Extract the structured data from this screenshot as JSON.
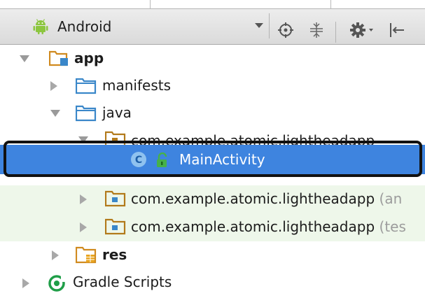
{
  "toolbar": {
    "view_label": "Android",
    "icons": [
      "android-icon",
      "chevron-down-icon",
      "sync-target-icon",
      "collapse-all-icon",
      "settings-gear-icon",
      "hide-panel-icon"
    ]
  },
  "tree": {
    "app": "app",
    "manifests": "manifests",
    "java": "java",
    "package_main": "com.example.atomic.lightheadapp",
    "main_activity": "MainActivity",
    "package_android_test": "com.example.atomic.lightheadapp",
    "package_android_test_suffix": "(an",
    "package_test": "com.example.atomic.lightheadapp",
    "package_test_suffix": "(tes",
    "res": "res",
    "gradle_scripts": "Gradle Scripts"
  },
  "colors": {
    "selection": "#3e84df",
    "folder_blue": "#3a87c9",
    "android_green": "#8cc63f",
    "gradle_green": "#1f9e48",
    "test_row_tint": "#eef7ea"
  }
}
